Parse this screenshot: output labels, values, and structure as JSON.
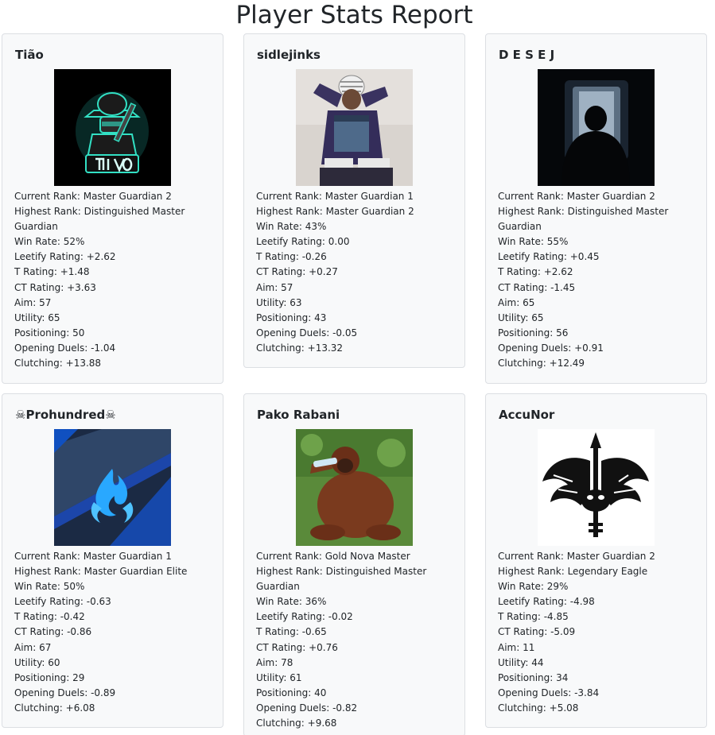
{
  "title": "Player Stats Report",
  "players": [
    {
      "name": "Tião",
      "avatar_icon": "masked-gunman-logo",
      "stats": [
        "Current Rank: Master Guardian 2",
        "Highest Rank: Distinguished Master Guardian",
        "Win Rate: 52%",
        "Leetify Rating: +2.62",
        "T Rating: +1.48",
        "CT Rating: +3.63",
        "Aim: 57",
        "Utility: 65",
        "Positioning: 50",
        "Opening Duels: -1.04",
        "Clutching: +13.88"
      ]
    },
    {
      "name": "sidlejinks",
      "avatar_icon": "person-saluting-photo",
      "stats": [
        "Current Rank: Master Guardian 1",
        "Highest Rank: Master Guardian 2",
        "Win Rate: 43%",
        "Leetify Rating: 0.00",
        "T Rating: -0.26",
        "CT Rating: +0.27",
        "Aim: 57",
        "Utility: 63",
        "Positioning: 43",
        "Opening Duels: -0.05",
        "Clutching: +13.32"
      ]
    },
    {
      "name": "D E S E J",
      "avatar_icon": "dark-silhouette-doorway",
      "stats": [
        "Current Rank: Master Guardian 2",
        "Highest Rank: Distinguished Master Guardian",
        "Win Rate: 55%",
        "Leetify Rating: +0.45",
        "T Rating: +2.62",
        "CT Rating: -1.45",
        "Aim: 65",
        "Utility: 65",
        "Positioning: 56",
        "Opening Duels: +0.91",
        "Clutching: +12.49"
      ]
    },
    {
      "name": "Prohundred",
      "name_prefix": "☠",
      "name_suffix": "☠",
      "avatar_icon": "blue-flame-logo",
      "stats": [
        "Current Rank: Master Guardian 1",
        "Highest Rank: Master Guardian Elite",
        "Win Rate: 50%",
        "Leetify Rating: -0.63",
        "T Rating: -0.42",
        "CT Rating: -0.86",
        "Aim: 67",
        "Utility: 60",
        "Positioning: 29",
        "Opening Duels: -0.89",
        "Clutching: +6.08"
      ]
    },
    {
      "name": "Pako Rabani",
      "avatar_icon": "orangutan-photo",
      "stats": [
        "Current Rank: Gold Nova Master",
        "Highest Rank: Distinguished Master Guardian",
        "Win Rate: 36%",
        "Leetify Rating: -0.02",
        "T Rating: -0.65",
        "CT Rating: +0.76",
        "Aim: 78",
        "Utility: 61",
        "Positioning: 40",
        "Opening Duels: -0.82",
        "Clutching: +9.68"
      ]
    },
    {
      "name": "AccuNor",
      "avatar_icon": "winged-spear-emblem",
      "stats": [
        "Current Rank: Master Guardian 2",
        "Highest Rank: Legendary Eagle",
        "Win Rate: 29%",
        "Leetify Rating: -4.98",
        "T Rating: -4.85",
        "CT Rating: -5.09",
        "Aim: 11",
        "Utility: 44",
        "Positioning: 34",
        "Opening Duels: -3.84",
        "Clutching: +5.08"
      ]
    }
  ]
}
